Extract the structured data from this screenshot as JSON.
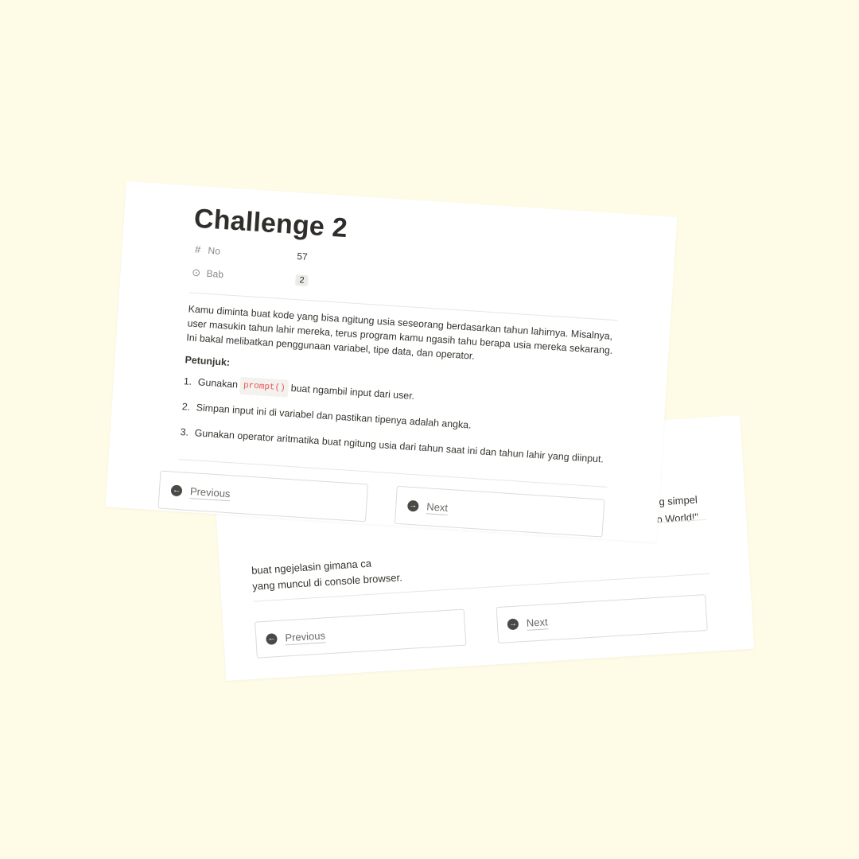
{
  "colors": {
    "background": "#fefbe7",
    "card": "#ffffff",
    "text": "#37352f",
    "muted": "#8a8985",
    "code_text": "#eb5757"
  },
  "back_card": {
    "peek_top_lines": [
      "n yang simpel",
      "o World!\""
    ],
    "peek_bottom_lines": [
      "buat ngejelasin gimana ca",
      "yang muncul di console browser."
    ],
    "prev": {
      "label": "Previous",
      "icon": "arrow-left-circle-icon"
    },
    "next": {
      "label": "Next",
      "icon": "arrow-right-circle-icon"
    }
  },
  "front_card": {
    "title": "Challenge 2",
    "properties": [
      {
        "icon": "hash-icon",
        "glyph": "#",
        "name": "No",
        "value": "57"
      },
      {
        "icon": "select-icon",
        "glyph": "⊙",
        "name": "Bab",
        "value": "2"
      }
    ],
    "description": "Kamu diminta buat kode yang bisa ngitung usia seseorang berdasarkan tahun lahirnya. Misalnya, user masukin tahun lahir mereka, terus program kamu ngasih tahu berapa usia mereka sekarang. Ini bakal melibatkan penggunaan variabel, tipe data, dan operator.",
    "hint_heading": "Petunjuk:",
    "steps": [
      {
        "num": "1.",
        "before": "Gunakan",
        "code": "prompt()",
        "after": "buat ngambil input dari user."
      },
      {
        "num": "2.",
        "before": "Simpan input ini di variabel dan pastikan tipenya adalah angka.",
        "code": "",
        "after": ""
      },
      {
        "num": "3.",
        "before": "Gunakan operator aritmatika buat ngitung usia dari tahun saat ini dan tahun lahir yang diinput.",
        "code": "",
        "after": ""
      }
    ],
    "prev": {
      "label": "Previous",
      "icon": "arrow-left-circle-icon"
    },
    "next": {
      "label": "Next",
      "icon": "arrow-right-circle-icon"
    }
  }
}
